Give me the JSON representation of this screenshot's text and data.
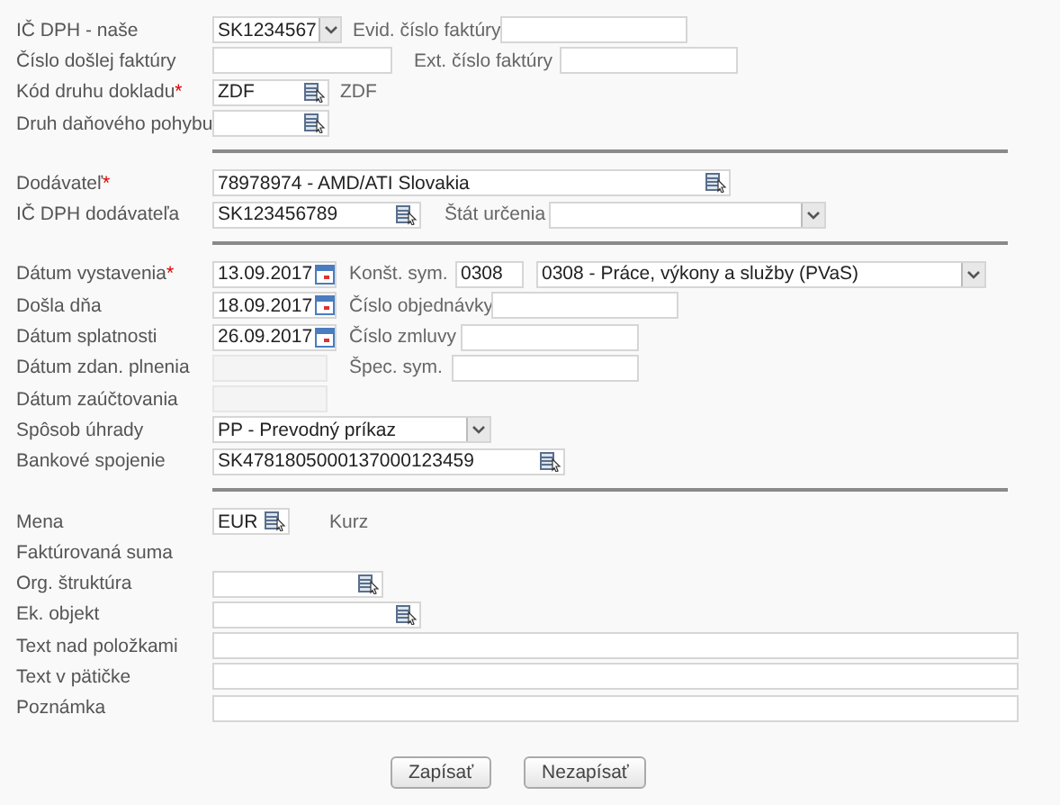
{
  "sections": [
    {
      "rows": [
        {
          "label": "IČ DPH - naše",
          "controls": [
            {
              "kind": "select",
              "value": "SK1234567"
            },
            {
              "kind": "label",
              "text": "Evid. číslo faktúry"
            },
            {
              "kind": "text"
            }
          ]
        },
        {
          "label": "Číslo došlej faktúry",
          "controls": [
            {
              "kind": "text"
            },
            {
              "kind": "label",
              "text": "Ext. číslo faktúry"
            },
            {
              "kind": "text"
            }
          ]
        },
        {
          "label": "Kód druhu dokladu",
          "required_mark": "*",
          "controls": [
            {
              "kind": "lookup",
              "value": "ZDF"
            },
            {
              "kind": "static",
              "text": "ZDF"
            }
          ]
        },
        {
          "label": "Druh daňového pohybu",
          "controls": [
            {
              "kind": "lookup"
            }
          ]
        }
      ]
    },
    {
      "rows": [
        {
          "label": "Dodávateľ",
          "required_mark": "*",
          "controls": [
            {
              "kind": "lookup",
              "value": "78978974 - AMD/ATI Slovakia"
            }
          ]
        },
        {
          "label": "IČ DPH dodávateľa",
          "controls": [
            {
              "kind": "lookup",
              "value": "SK123456789"
            },
            {
              "kind": "label",
              "text": "Štát určenia"
            },
            {
              "kind": "select"
            }
          ]
        }
      ]
    },
    {
      "rows": [
        {
          "label": "Dátum vystavenia",
          "required_mark": "*",
          "controls": [
            {
              "kind": "date",
              "value": "13.09.2017"
            },
            {
              "kind": "label",
              "text": "Konšt. sym."
            },
            {
              "kind": "text",
              "value": "0308"
            },
            {
              "kind": "select",
              "value": "0308 - Práce, výkony a služby (PVaS)"
            }
          ]
        },
        {
          "label": "Došla dňa",
          "controls": [
            {
              "kind": "date",
              "value": "18.09.2017"
            },
            {
              "kind": "label",
              "text": "Číslo objednávky"
            },
            {
              "kind": "text"
            }
          ]
        },
        {
          "label": "Dátum splatnosti",
          "controls": [
            {
              "kind": "date",
              "value": "26.09.2017"
            },
            {
              "kind": "label",
              "text": "Číslo zmluvy"
            },
            {
              "kind": "text"
            }
          ]
        },
        {
          "label": "Dátum zdan. plnenia",
          "controls": [
            {
              "kind": "text",
              "disabled": true
            },
            {
              "kind": "label",
              "text": "Špec. sym."
            },
            {
              "kind": "text"
            }
          ]
        },
        {
          "label": "Dátum zaúčtovania",
          "controls": [
            {
              "kind": "text",
              "disabled": true
            }
          ]
        },
        {
          "label": "Spôsob úhrady",
          "controls": [
            {
              "kind": "select",
              "value": "PP - Prevodný príkaz"
            }
          ]
        },
        {
          "label": "Bankové spojenie",
          "controls": [
            {
              "kind": "lookup",
              "value": "SK4781805000137000123459"
            }
          ]
        }
      ]
    },
    {
      "rows": [
        {
          "label": "Mena",
          "controls": [
            {
              "kind": "lookup",
              "value": "EUR"
            },
            {
              "kind": "static",
              "text": "Kurz"
            }
          ]
        },
        {
          "label": "Faktúrovaná suma",
          "controls": []
        },
        {
          "label": "Org. štruktúra",
          "controls": [
            {
              "kind": "lookup"
            }
          ]
        },
        {
          "label": "Ek. objekt",
          "controls": [
            {
              "kind": "lookup"
            }
          ]
        },
        {
          "label": "Text nad položkami",
          "controls": [
            {
              "kind": "text"
            }
          ]
        },
        {
          "label": "Text v pätičke",
          "controls": [
            {
              "kind": "text"
            }
          ]
        },
        {
          "label": "Poznámka",
          "controls": [
            {
              "kind": "text"
            }
          ]
        }
      ]
    }
  ],
  "buttons": [
    {
      "label": "Zapísať"
    },
    {
      "label": "Nezapísať"
    }
  ]
}
